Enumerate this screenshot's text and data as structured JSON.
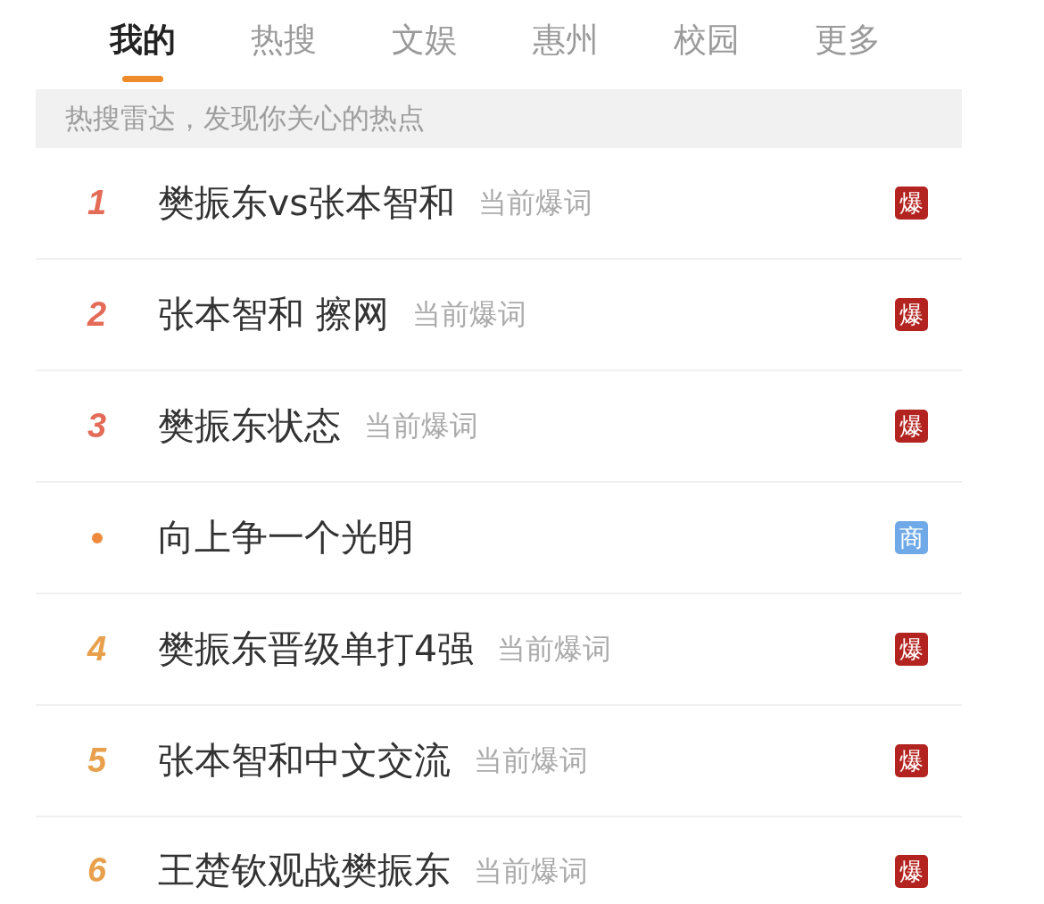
{
  "tabs": [
    {
      "label": "我的",
      "selected": true
    },
    {
      "label": "热搜",
      "selected": false
    },
    {
      "label": "文娱",
      "selected": false
    },
    {
      "label": "惠州",
      "selected": false
    },
    {
      "label": "校园",
      "selected": false
    },
    {
      "label": "更多",
      "selected": false
    }
  ],
  "banner": {
    "text": "热搜雷达，发现你关心的热点"
  },
  "hot_list": [
    {
      "kind": "ranked",
      "rank": "1",
      "color": "#e36b57",
      "title": "樊振东vs张本智和",
      "tag": "当前爆词",
      "badge": {
        "text": "爆",
        "color": "#b3231f"
      }
    },
    {
      "kind": "ranked",
      "rank": "2",
      "color": "#e36b57",
      "title": "张本智和 擦网",
      "tag": "当前爆词",
      "badge": {
        "text": "爆",
        "color": "#b3231f"
      }
    },
    {
      "kind": "ranked",
      "rank": "3",
      "color": "#e36b57",
      "title": "樊振东状态",
      "tag": "当前爆词",
      "badge": {
        "text": "爆",
        "color": "#b3231f"
      }
    },
    {
      "kind": "promoted",
      "color": "#ef8a3c",
      "title": "向上争一个光明",
      "badge": {
        "text": "商",
        "color": "#6fa9e8"
      }
    },
    {
      "kind": "ranked",
      "rank": "4",
      "color": "#e8a04c",
      "title": "樊振东晋级单打4强",
      "tag": "当前爆词",
      "badge": {
        "text": "爆",
        "color": "#b3231f"
      }
    },
    {
      "kind": "ranked",
      "rank": "5",
      "color": "#e8a04c",
      "title": "张本智和中文交流",
      "tag": "当前爆词",
      "badge": {
        "text": "爆",
        "color": "#b3231f"
      }
    },
    {
      "kind": "ranked",
      "rank": "6",
      "color": "#e8a04c",
      "title": "王楚钦观战樊振东",
      "tag": "当前爆词",
      "badge": {
        "text": "爆",
        "color": "#b3231f"
      }
    }
  ]
}
